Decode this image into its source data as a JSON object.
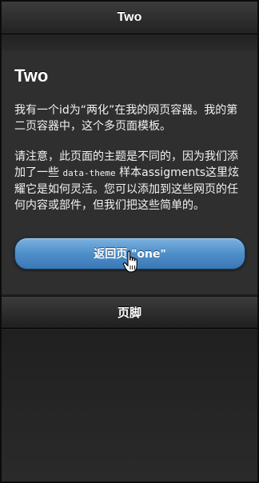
{
  "header": {
    "title": "Two"
  },
  "content": {
    "heading": "Two",
    "para1": "我有一个id为“两化”在我的网页容器。我的第二页容器中，这个多页面模板。",
    "para2": {
      "part1": "请注意，此页面的主题是不同的，因为我们添加了一些 ",
      "code": "data-theme",
      "part2": " 样本assigments这里炫耀它是如何灵活。您可以添加到这些网页的任何内容或部件，但我们把这些简单的。"
    }
  },
  "button": {
    "label": "返回页 \"one\""
  },
  "footer": {
    "title": "页脚"
  },
  "colors": {
    "button_top": "#7bb2e0",
    "button_bottom": "#3a78b5",
    "background": "#2f2f2f"
  },
  "icons": {
    "cursor": "hand-pointer-icon"
  }
}
